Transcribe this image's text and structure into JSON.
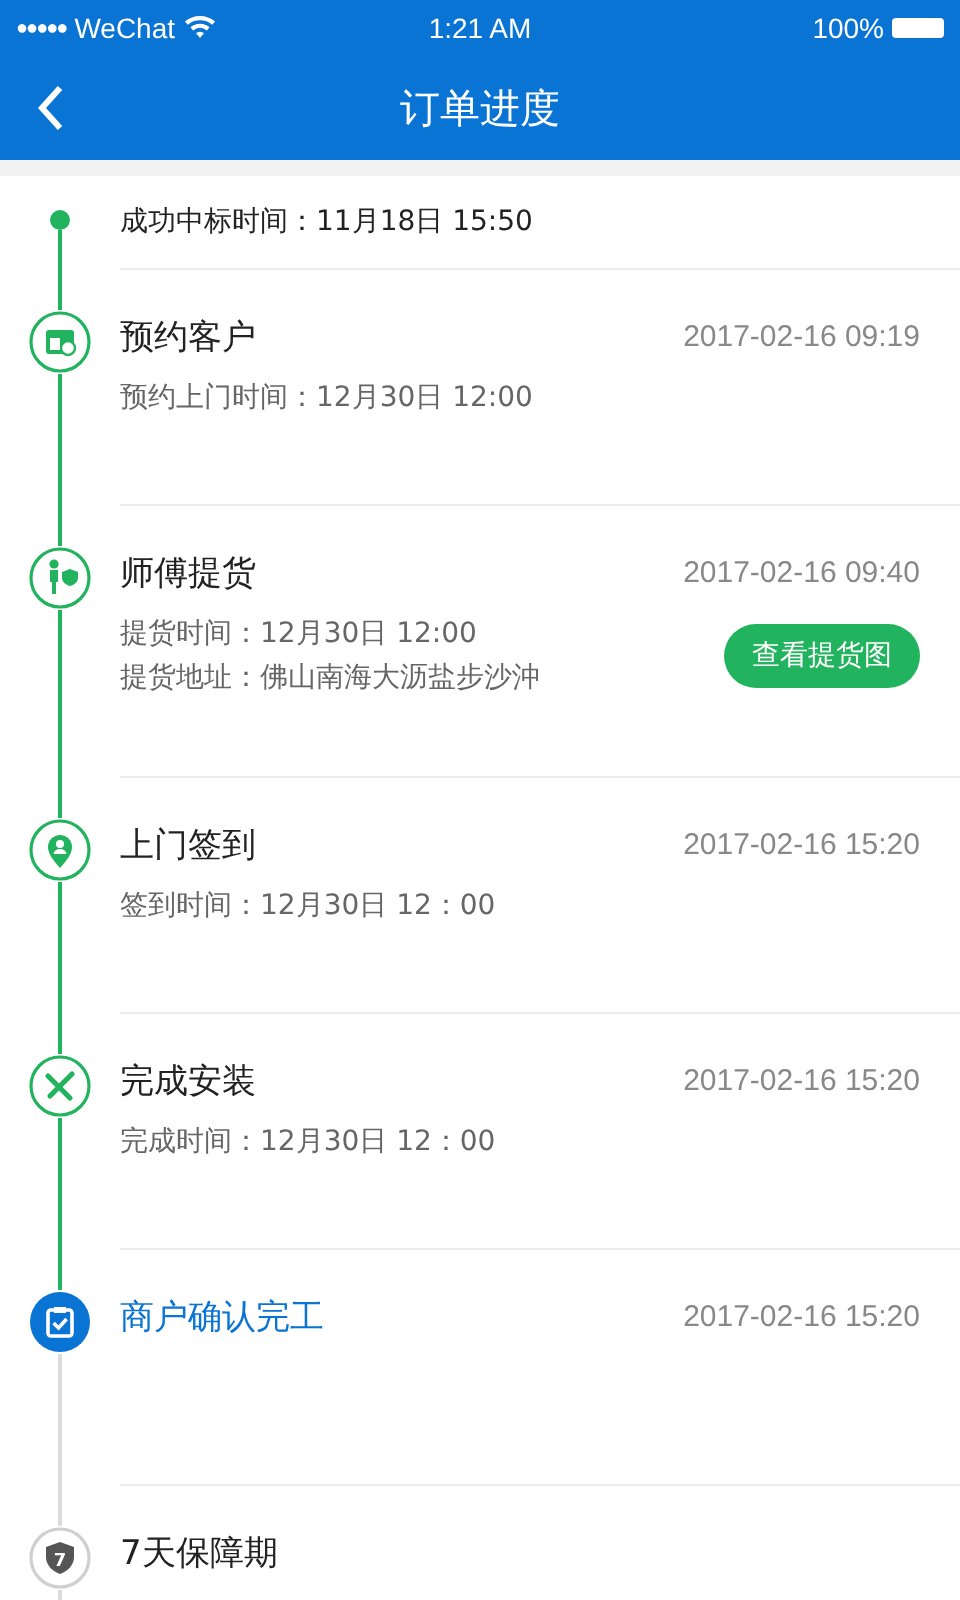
{
  "status_bar": {
    "signal": "●●●●●",
    "carrier": "WeChat",
    "time": "1:21 AM",
    "battery": "100%"
  },
  "header": {
    "title": "订单进度"
  },
  "bid": {
    "text": "成功中标时间：11月18日 15:50",
    "done": true
  },
  "steps": [
    {
      "kind": "calendar",
      "title": "预约客户",
      "time": "2017-02-16  09:19",
      "done": true,
      "current": false,
      "details": [
        "预约上门时间：12月30日 12:00"
      ]
    },
    {
      "kind": "courier",
      "title": "师傅提货",
      "time": "2017-02-16  09:40",
      "done": true,
      "current": false,
      "details": [
        "提货时间：12月30日 12:00",
        "提货地址：佛山南海大沥盐步沙沖"
      ],
      "button": "查看提货图"
    },
    {
      "kind": "pin",
      "title": "上门签到",
      "time": "2017-02-16  15:20",
      "done": true,
      "current": false,
      "details": [
        "签到时间：12月30日 12：00"
      ]
    },
    {
      "kind": "tools",
      "title": "完成安装",
      "time": "2017-02-16  15:20",
      "done": true,
      "current": false,
      "details": [
        "完成时间：12月30日 12：00"
      ]
    },
    {
      "kind": "clipboard",
      "title": "商户确认完工",
      "time": "2017-02-16  15:20",
      "done": false,
      "current": true
    },
    {
      "kind": "shield",
      "icon_text": "7",
      "title": "7天保障期",
      "done": false,
      "current": false
    }
  ]
}
